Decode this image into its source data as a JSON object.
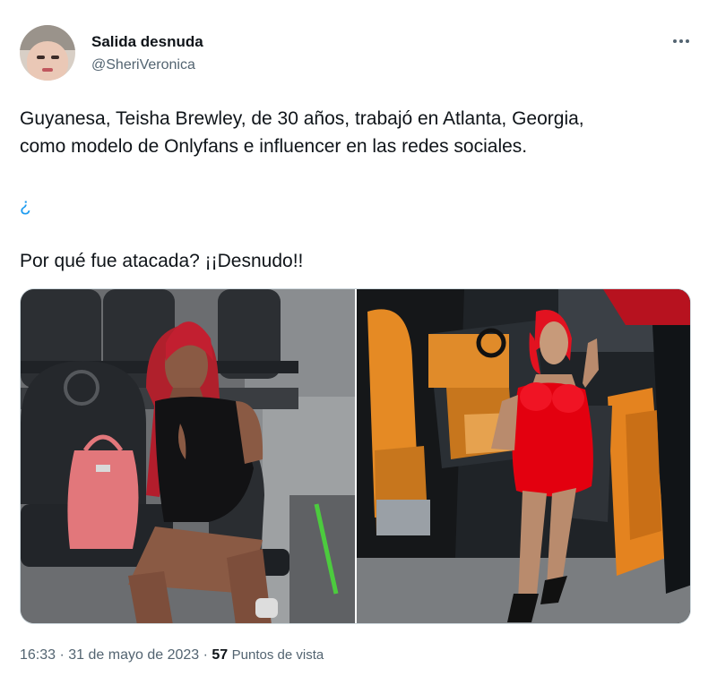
{
  "tweet": {
    "author": {
      "display_name": "Salida desnuda",
      "handle": "@SheriVeronica"
    },
    "text_lines": [
      "Guyanesa, Teisha Brewley, de 30 años, trabajó en Atlanta, Georgia,",
      "como modelo de Onlyfans e influencer en las redes sociales.",
      "¿",
      "Por qué fue atacada? ¡¡Desnudo!!"
    ],
    "meta": {
      "time": "16:33",
      "separator": "·",
      "date": "31 de mayo de 2023",
      "views_count": "57",
      "views_label": "Puntos de vista"
    }
  },
  "icons": {
    "more": "more-horizontal-icon"
  },
  "colors": {
    "text_primary": "#0f1419",
    "text_secondary": "#536471",
    "accent": "#1d9bf0"
  }
}
